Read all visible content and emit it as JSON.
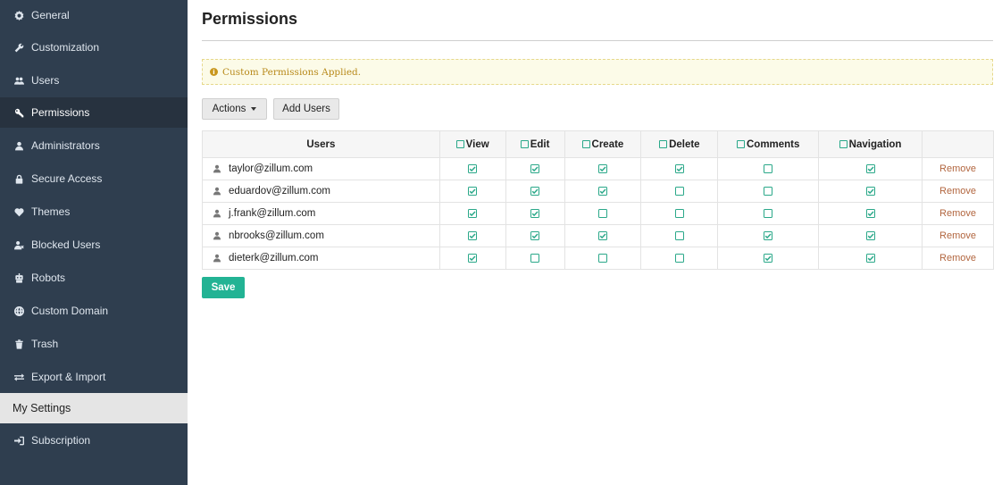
{
  "sidebar": {
    "items": [
      {
        "label": "General",
        "icon": "gear-icon"
      },
      {
        "label": "Customization",
        "icon": "wrench-icon"
      },
      {
        "label": "Users",
        "icon": "users-icon"
      },
      {
        "label": "Permissions",
        "icon": "key-icon"
      },
      {
        "label": "Administrators",
        "icon": "user-icon"
      },
      {
        "label": "Secure Access",
        "icon": "lock-icon"
      },
      {
        "label": "Themes",
        "icon": "heart-icon"
      },
      {
        "label": "Blocked Users",
        "icon": "user-x-icon"
      },
      {
        "label": "Robots",
        "icon": "robot-icon"
      },
      {
        "label": "Custom Domain",
        "icon": "globe-icon"
      },
      {
        "label": "Trash",
        "icon": "trash-icon"
      },
      {
        "label": "Export & Import",
        "icon": "exchange-icon"
      }
    ],
    "my_settings": "My Settings",
    "subscription": {
      "label": "Subscription",
      "icon": "sign-in-icon"
    }
  },
  "page": {
    "title": "Permissions"
  },
  "notice": {
    "text": "Custom Permissions Applied.",
    "icon": "info-icon"
  },
  "toolbar": {
    "actions_label": "Actions",
    "add_users_label": "Add Users"
  },
  "table": {
    "headers": {
      "users": "Users",
      "view": "View",
      "edit": "Edit",
      "create": "Create",
      "delete": "Delete",
      "comments": "Comments",
      "navigation": "Navigation"
    },
    "remove_label": "Remove",
    "rows": [
      {
        "email": "taylor@zillum.com",
        "perms": [
          true,
          true,
          true,
          true,
          false,
          true
        ]
      },
      {
        "email": "eduardov@zillum.com",
        "perms": [
          true,
          true,
          true,
          false,
          false,
          true
        ]
      },
      {
        "email": "j.frank@zillum.com",
        "perms": [
          true,
          true,
          false,
          false,
          false,
          true
        ]
      },
      {
        "email": "nbrooks@zillum.com",
        "perms": [
          true,
          true,
          true,
          false,
          true,
          true
        ]
      },
      {
        "email": "dieterk@zillum.com",
        "perms": [
          true,
          false,
          false,
          false,
          true,
          true
        ]
      }
    ]
  },
  "save_label": "Save",
  "colors": {
    "sidebar_bg": "#2f3e4f",
    "sidebar_active": "#27323f",
    "accent": "#22b394",
    "check": "#2aa889",
    "remove": "#b2663f",
    "notice_text": "#b88a1b"
  }
}
